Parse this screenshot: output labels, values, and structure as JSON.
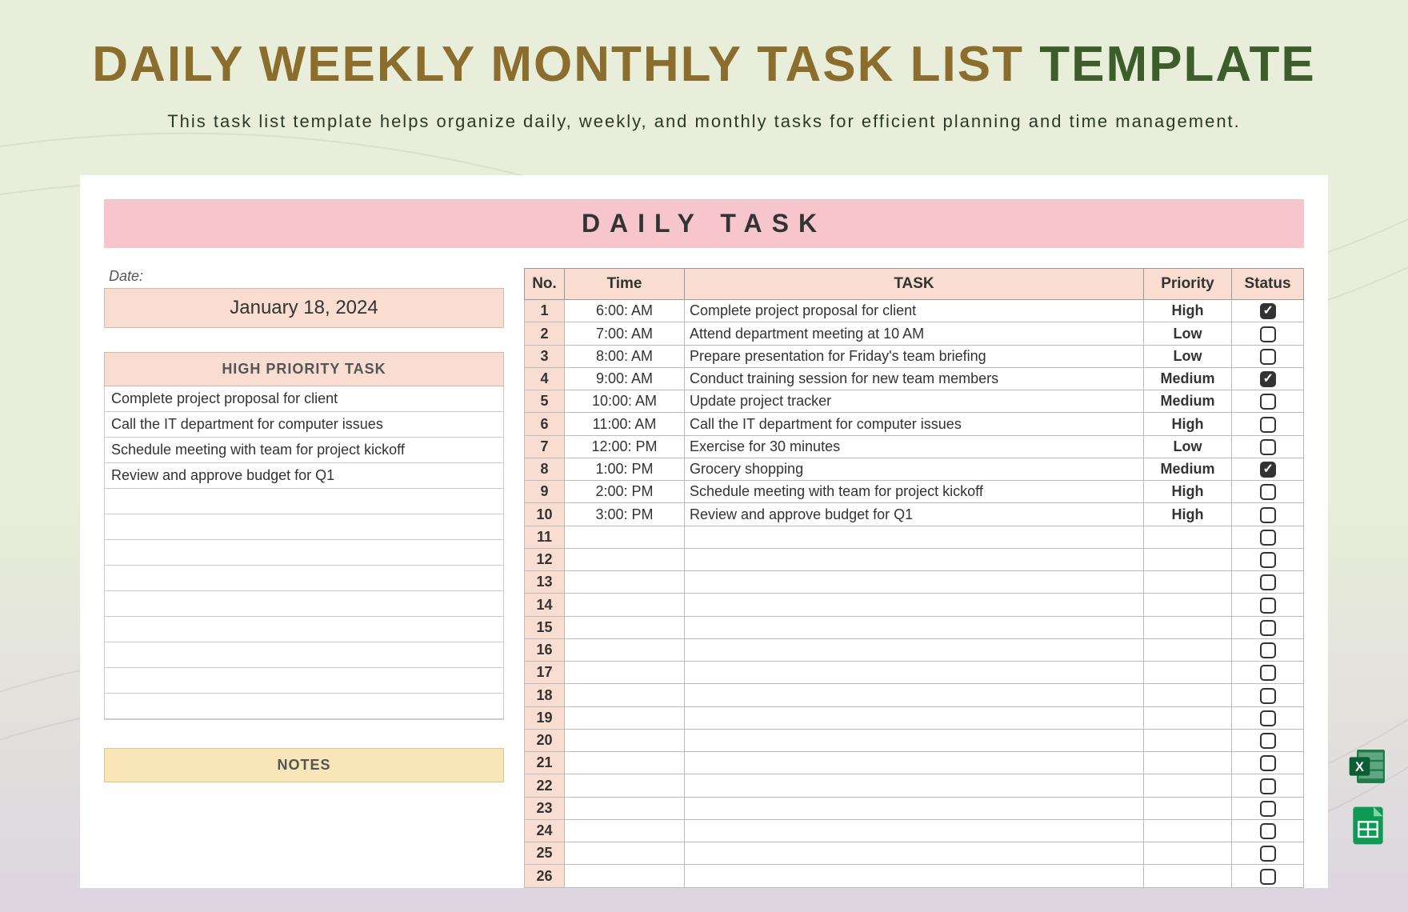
{
  "title_main": "DAILY WEEKLY MONTHLY TASK LIST",
  "title_accent": "TEMPLATE",
  "subtitle": "This task list template helps organize daily, weekly, and monthly tasks for efficient planning and time management.",
  "banner": "DAILY TASK",
  "date_label": "Date:",
  "date_value": "January 18, 2024",
  "hp_header": "HIGH PRIORITY TASK",
  "hp_items": [
    "Complete project proposal for client",
    "Call the IT department for computer issues",
    "Schedule meeting with team for project kickoff",
    "Review and approve budget for Q1",
    "",
    "",
    "",
    "",
    "",
    "",
    "",
    "",
    ""
  ],
  "notes_header": "NOTES",
  "cols": {
    "no": "No.",
    "time": "Time",
    "task": "TASK",
    "priority": "Priority",
    "status": "Status"
  },
  "rows": [
    {
      "n": "1",
      "time": "6:00: AM",
      "task": "Complete project proposal for client",
      "prio": "High",
      "chk": true
    },
    {
      "n": "2",
      "time": "7:00: AM",
      "task": "Attend department meeting at 10 AM",
      "prio": "Low",
      "chk": false
    },
    {
      "n": "3",
      "time": "8:00: AM",
      "task": "Prepare presentation for Friday's team briefing",
      "prio": "Low",
      "chk": false
    },
    {
      "n": "4",
      "time": "9:00: AM",
      "task": "Conduct training session for new team members",
      "prio": "Medium",
      "chk": true
    },
    {
      "n": "5",
      "time": "10:00: AM",
      "task": "Update project tracker",
      "prio": "Medium",
      "chk": false
    },
    {
      "n": "6",
      "time": "11:00: AM",
      "task": "Call the IT department for computer issues",
      "prio": "High",
      "chk": false
    },
    {
      "n": "7",
      "time": "12:00: PM",
      "task": "Exercise for 30 minutes",
      "prio": "Low",
      "chk": false
    },
    {
      "n": "8",
      "time": "1:00: PM",
      "task": "Grocery shopping",
      "prio": "Medium",
      "chk": true
    },
    {
      "n": "9",
      "time": "2:00: PM",
      "task": "Schedule meeting with team for project kickoff",
      "prio": "High",
      "chk": false
    },
    {
      "n": "10",
      "time": "3:00: PM",
      "task": "Review and approve budget for Q1",
      "prio": "High",
      "chk": false
    },
    {
      "n": "11",
      "time": "",
      "task": "",
      "prio": "",
      "chk": false
    },
    {
      "n": "12",
      "time": "",
      "task": "",
      "prio": "",
      "chk": false
    },
    {
      "n": "13",
      "time": "",
      "task": "",
      "prio": "",
      "chk": false
    },
    {
      "n": "14",
      "time": "",
      "task": "",
      "prio": "",
      "chk": false
    },
    {
      "n": "15",
      "time": "",
      "task": "",
      "prio": "",
      "chk": false
    },
    {
      "n": "16",
      "time": "",
      "task": "",
      "prio": "",
      "chk": false
    },
    {
      "n": "17",
      "time": "",
      "task": "",
      "prio": "",
      "chk": false
    },
    {
      "n": "18",
      "time": "",
      "task": "",
      "prio": "",
      "chk": false
    },
    {
      "n": "19",
      "time": "",
      "task": "",
      "prio": "",
      "chk": false
    },
    {
      "n": "20",
      "time": "",
      "task": "",
      "prio": "",
      "chk": false
    },
    {
      "n": "21",
      "time": "",
      "task": "",
      "prio": "",
      "chk": false
    },
    {
      "n": "22",
      "time": "",
      "task": "",
      "prio": "",
      "chk": false
    },
    {
      "n": "23",
      "time": "",
      "task": "",
      "prio": "",
      "chk": false
    },
    {
      "n": "24",
      "time": "",
      "task": "",
      "prio": "",
      "chk": false
    },
    {
      "n": "25",
      "time": "",
      "task": "",
      "prio": "",
      "chk": false
    },
    {
      "n": "26",
      "time": "",
      "task": "",
      "prio": "",
      "chk": false
    }
  ]
}
